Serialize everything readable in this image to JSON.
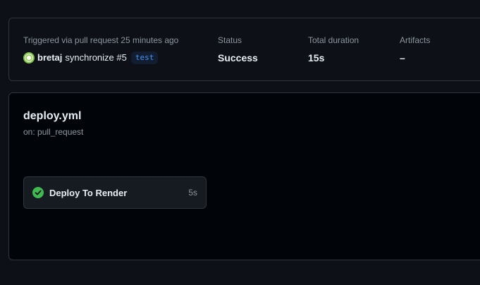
{
  "summary": {
    "trigger_label": "Triggered via pull request 25 minutes ago",
    "user": "bretaj",
    "event": "synchronize #5",
    "branch": "test",
    "status_label": "Status",
    "status_value": "Success",
    "duration_label": "Total duration",
    "duration_value": "15s",
    "artifacts_label": "Artifacts",
    "artifacts_value": "–"
  },
  "workflow": {
    "title": "deploy.yml",
    "trigger": "on: pull_request",
    "jobs": [
      {
        "name": "Deploy To Render",
        "duration": "5s",
        "status": "success"
      }
    ]
  },
  "colors": {
    "success": "#3fb950",
    "link": "#4493f8"
  }
}
